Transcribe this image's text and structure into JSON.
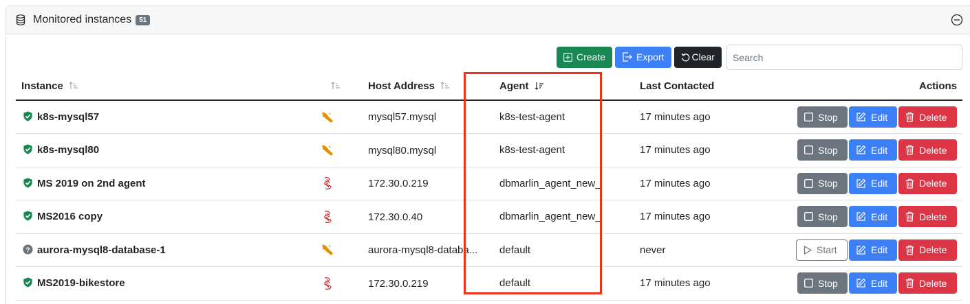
{
  "header": {
    "title": "Monitored instances",
    "count": "51"
  },
  "toolbar": {
    "create_label": "Create",
    "export_label": "Export",
    "clear_label": "Clear"
  },
  "search": {
    "placeholder": "Search",
    "value": ""
  },
  "columns": {
    "instance": "Instance",
    "type": "",
    "host": "Host Address",
    "agent": "Agent",
    "last": "Last Contacted",
    "actions": "Actions"
  },
  "rows": [
    {
      "name": "k8s-mysql57",
      "status": "shield-check",
      "db_type": "mysql",
      "host": "mysql57.mysql",
      "agent": "k8s-test-agent",
      "last": "17 minutes ago",
      "toggle": "Stop",
      "edit": "Edit",
      "delete": "Delete"
    },
    {
      "name": "k8s-mysql80",
      "status": "shield-check",
      "db_type": "mysql",
      "host": "mysql80.mysql",
      "agent": "k8s-test-agent",
      "last": "17 minutes ago",
      "toggle": "Stop",
      "edit": "Edit",
      "delete": "Delete"
    },
    {
      "name": "MS 2019 on 2nd agent",
      "status": "shield-check",
      "db_type": "sqlserver",
      "host": "172.30.0.219",
      "agent": "dbmarlin_agent_new_",
      "last": "17 minutes ago",
      "toggle": "Stop",
      "edit": "Edit",
      "delete": "Delete"
    },
    {
      "name": "MS2016 copy",
      "status": "shield-check",
      "db_type": "sqlserver",
      "host": "172.30.0.40",
      "agent": "dbmarlin_agent_new_",
      "last": "17 minutes ago",
      "toggle": "Stop",
      "edit": "Edit",
      "delete": "Delete"
    },
    {
      "name": "aurora-mysql8-database-1",
      "status": "question-circle",
      "db_type": "mysql",
      "host": "aurora-mysql8-databa...",
      "agent": "default",
      "last": "never",
      "toggle": "Start",
      "edit": "Edit",
      "delete": "Delete"
    },
    {
      "name": "MS2019-bikestore",
      "status": "shield-check",
      "db_type": "sqlserver",
      "host": "172.30.0.219",
      "agent": "default",
      "last": "17 minutes ago",
      "toggle": "Stop",
      "edit": "Edit",
      "delete": "Delete"
    }
  ],
  "colors": {
    "green": "#198754",
    "blue": "#3d7ff5",
    "dark": "#212529",
    "gray": "#6c757d",
    "red": "#dc3545",
    "highlight": "#f0311c",
    "mysql": "#e48e00",
    "sqlserver": "#cc2927"
  }
}
